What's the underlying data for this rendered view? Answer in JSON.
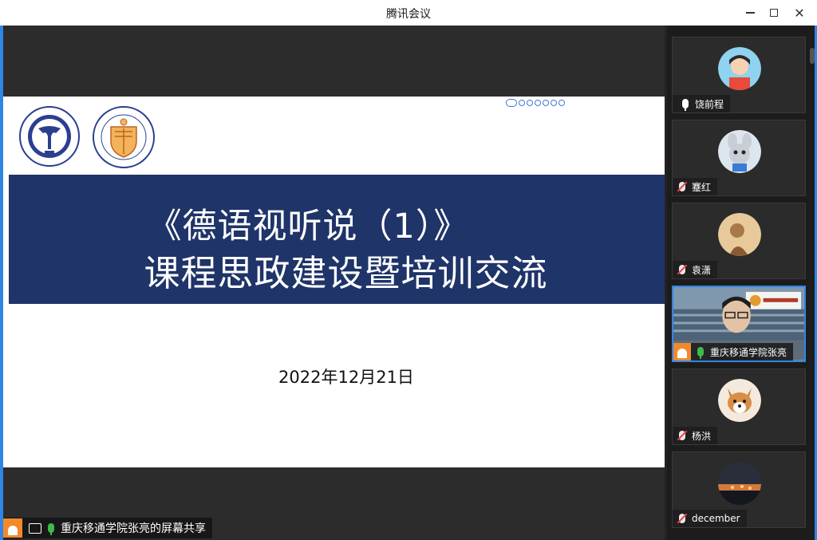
{
  "window": {
    "title": "腾讯会议"
  },
  "slide": {
    "title_line1": "《德语视听说（1）》",
    "title_line2": "课程思政建设暨培训交流",
    "date": "2022年12月21日"
  },
  "share_bar": {
    "label": "重庆移通学院张亮的屏幕共享"
  },
  "participants": [
    {
      "name": "饶前程",
      "audio": "on"
    },
    {
      "name": "蹇红",
      "audio": "muted"
    },
    {
      "name": "袁潇",
      "audio": "muted"
    },
    {
      "name": "重庆移通学院张亮",
      "audio": "speaking",
      "video": true
    },
    {
      "name": "杨洪",
      "audio": "muted"
    },
    {
      "name": "december",
      "audio": "muted"
    }
  ],
  "colors": {
    "accent": "#2f86e6",
    "banner": "#1f3468",
    "speaking": "#3dbb4c",
    "muted_slash": "#e8434a",
    "avatar_orange": "#f28a2c"
  }
}
